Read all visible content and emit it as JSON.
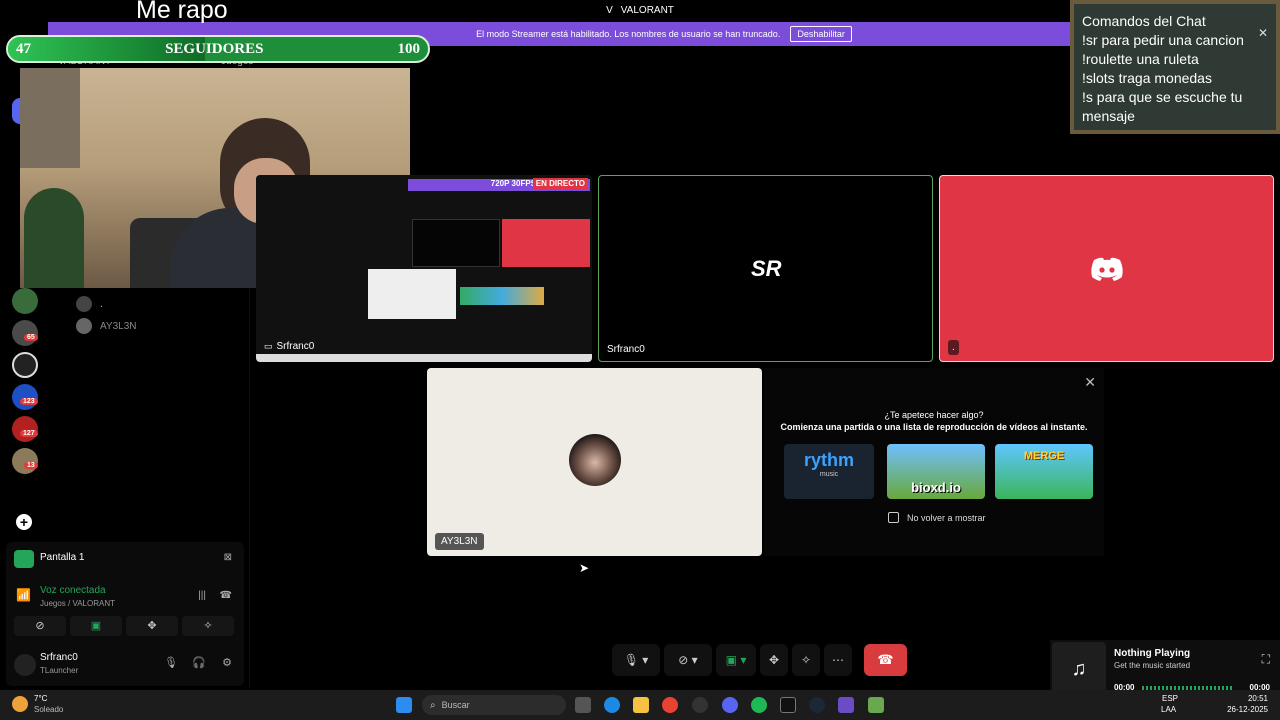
{
  "window": {
    "title": "VALORANT",
    "prefix": "V"
  },
  "overlay": {
    "title": "Me rapo"
  },
  "follower_goal": {
    "current": "47",
    "label": "SEGUIDORES",
    "goal": "100",
    "progress": 0.47
  },
  "streamer_banner": {
    "text": "El modo Streamer está habilitado. Los nombres de usuario se han truncado.",
    "button": "Deshabilitar"
  },
  "channel_header": {
    "server": "VALORANT",
    "channel": "Juegos"
  },
  "server_badges": [
    "65",
    "123",
    "127",
    "13"
  ],
  "voice_members": [
    {
      "name": "."
    },
    {
      "name": "AY3L3N"
    }
  ],
  "tiles": {
    "stream_preview": {
      "quality": "720P 30FPS",
      "live": "EN DIRECTO",
      "label": "Srfranc0"
    },
    "tile_sr": {
      "label": "Srfranc0",
      "logo": "SR"
    },
    "tile_discord": {
      "label": "."
    },
    "tile_ay3l3n": {
      "label": "AY3L3N"
    }
  },
  "activity": {
    "title": "¿Te apetece hacer algo?",
    "subtitle": "Comienza una partida o una lista de reproducción de vídeos al instante.",
    "games": [
      {
        "name": "rythm",
        "sub": "music"
      },
      {
        "name": "bioxd.io"
      },
      {
        "name": "MERGE"
      }
    ],
    "checkbox": "No volver a mostrar"
  },
  "user_panel": {
    "screen_share": "Pantalla 1",
    "voice_status": "Voz conectada",
    "voice_channel": "Juegos / VALORANT",
    "username": "Srfranc0",
    "user_status": "TLauncher"
  },
  "music_widget": {
    "title": "Nothing Playing",
    "subtitle": "Get the music started",
    "time_start": "00:00",
    "time_end": "00:00"
  },
  "chat_commands": {
    "title": "Comandos del Chat",
    "lines": [
      "!sr para pedir una cancion",
      "!roulette una ruleta",
      "!slots traga monedas",
      "!s para que se escuche tu",
      "mensaje"
    ]
  },
  "taskbar": {
    "weather_temp": "7°C",
    "weather_desc": "Soleado",
    "search_placeholder": "Buscar",
    "lang": "ESP",
    "lang_sub": "LAA",
    "time": "20:51",
    "date": "26-12-2025"
  },
  "colors": {
    "discord_red": "#e03545",
    "streamer_purple": "#7c4ddb",
    "green": "#23a55a",
    "end_call": "#d83c3e"
  }
}
